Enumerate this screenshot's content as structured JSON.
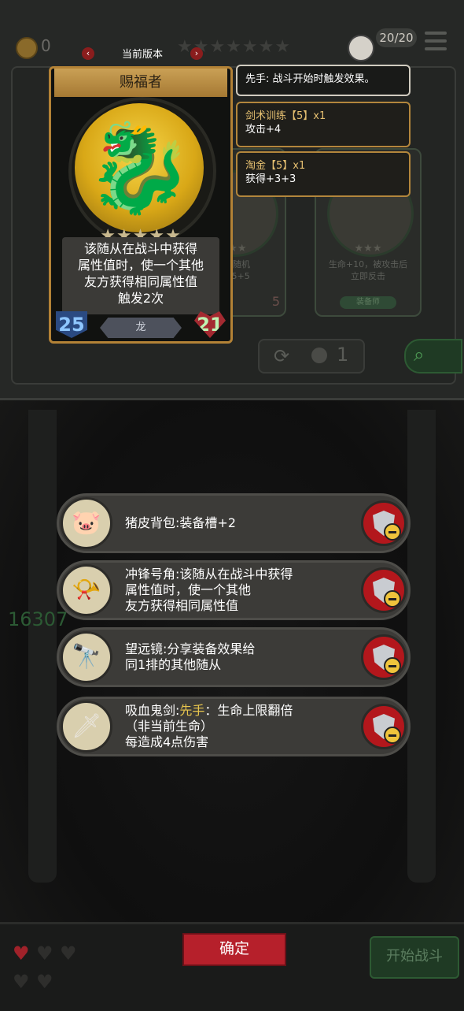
{
  "header": {
    "coins": "0",
    "stars": "★★★★★★★",
    "population": "20/20"
  },
  "version": {
    "label": "当前版本",
    "prev": "‹",
    "next": "›"
  },
  "unit_card": {
    "name": "赐福者",
    "stars": "★★★★★",
    "description_lines": [
      "该随从在战斗中获得",
      "属性值时，使一个其他",
      "友方获得相同属性值",
      "触发2次"
    ],
    "attack": "25",
    "health": "21",
    "tribe": "龙",
    "portrait_icon": "golden-dragon"
  },
  "tooltips": [
    {
      "title": "",
      "body": "先手: 战斗开始时触发效果。",
      "style": "plain"
    },
    {
      "title": "剑术训练【5】x1",
      "body": "攻击+4",
      "style": "gold"
    },
    {
      "title": "淘金【5】x1",
      "body": "获得+3+3",
      "style": "gold"
    }
  ],
  "shop_cards": [
    {
      "stars": "★★★",
      "desc": "包个随机\n得+5+5",
      "tribe": "",
      "hp": "5"
    },
    {
      "stars": "★★★",
      "desc": "生命+10，被攻击后\n立即反击",
      "tribe": "装备师",
      "hp": ""
    }
  ],
  "refresh": {
    "cost": "1"
  },
  "faint_score": "16307",
  "equipment": [
    {
      "icon": "pig-backpack",
      "glyph": "🐷",
      "text": "猪皮背包:装备槽+2",
      "keyword": "",
      "after": ""
    },
    {
      "icon": "charge-horn",
      "glyph": "📯",
      "text": "冲锋号角:该随从在战斗中获得属性值时，使一个其他友方获得相同属性值",
      "keyword": "",
      "after": ""
    },
    {
      "icon": "telescope",
      "glyph": "🔭",
      "text": "望远镜:分享装备效果给同1排的其他随从",
      "keyword": "",
      "after": ""
    },
    {
      "icon": "vampire-sword",
      "glyph": "🗡",
      "text": "吸血鬼剑:",
      "keyword": "先手",
      "after": "：生命上限翻倍（非当前生命）每造成4点伤害"
    }
  ],
  "equipment_lines": [
    [
      "猪皮背包:装备槽+2"
    ],
    [
      "冲锋号角:该随从在战斗中获得",
      "属性值时，使一个其他",
      "友方获得相同属性值"
    ],
    [
      "望远镜:分享装备效果给",
      "同1排的其他随从"
    ],
    [
      "吸血鬼剑:先手：生命上限翻倍",
      "（非当前生命）",
      "每造成4点伤害"
    ]
  ],
  "lives": {
    "filled": 1,
    "total": 5
  },
  "buttons": {
    "confirm": "确定",
    "start_battle": "开始战斗"
  },
  "colors": {
    "gold_frame": "#b38236",
    "confirm_red": "#b6202b",
    "keyword_yellow": "#e7c54d"
  }
}
